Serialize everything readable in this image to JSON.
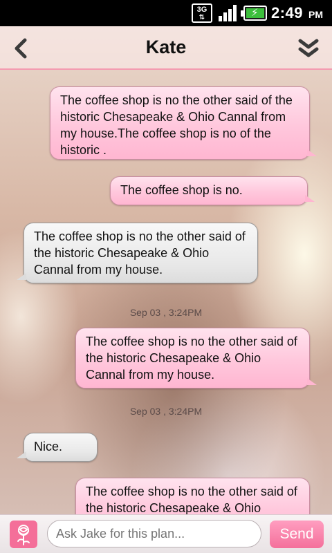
{
  "status_bar": {
    "network": "3G",
    "time": "2:49",
    "ampm": "PM"
  },
  "header": {
    "title": "Kate"
  },
  "messages": [
    {
      "side": "out",
      "text": "The coffee shop is no the other said of the historic Chesapeake & Ohio Cannal from my house.The coffee shop is no of the historic ."
    },
    {
      "side": "out",
      "text": "The coffee shop is no."
    },
    {
      "side": "in",
      "text": "The coffee shop is no the other said of the historic Chesapeake & Ohio Cannal from my house."
    },
    {
      "timestamp": "Sep 03 , 3:24PM"
    },
    {
      "side": "out",
      "text": "The coffee shop is no the other said of the historic Chesapeake & Ohio Cannal from my house."
    },
    {
      "timestamp": "Sep 03 , 3:24PM"
    },
    {
      "side": "in",
      "text": "Nice."
    },
    {
      "side": "out",
      "text": "The coffee shop is no the other said of the historic Chesapeake & Ohio"
    }
  ],
  "composer": {
    "placeholder": "Ask Jake for this plan...",
    "send_label": "Send"
  },
  "icons": {
    "back": "chevron-left-icon",
    "more": "double-chevron-down-icon",
    "rose": "rose-icon",
    "signal": "signal-icon",
    "battery": "battery-charging-icon"
  },
  "colors": {
    "accent": "#f46f99",
    "outgoing_bubble": "#ffc7dc",
    "incoming_bubble": "#e8e8e8"
  }
}
